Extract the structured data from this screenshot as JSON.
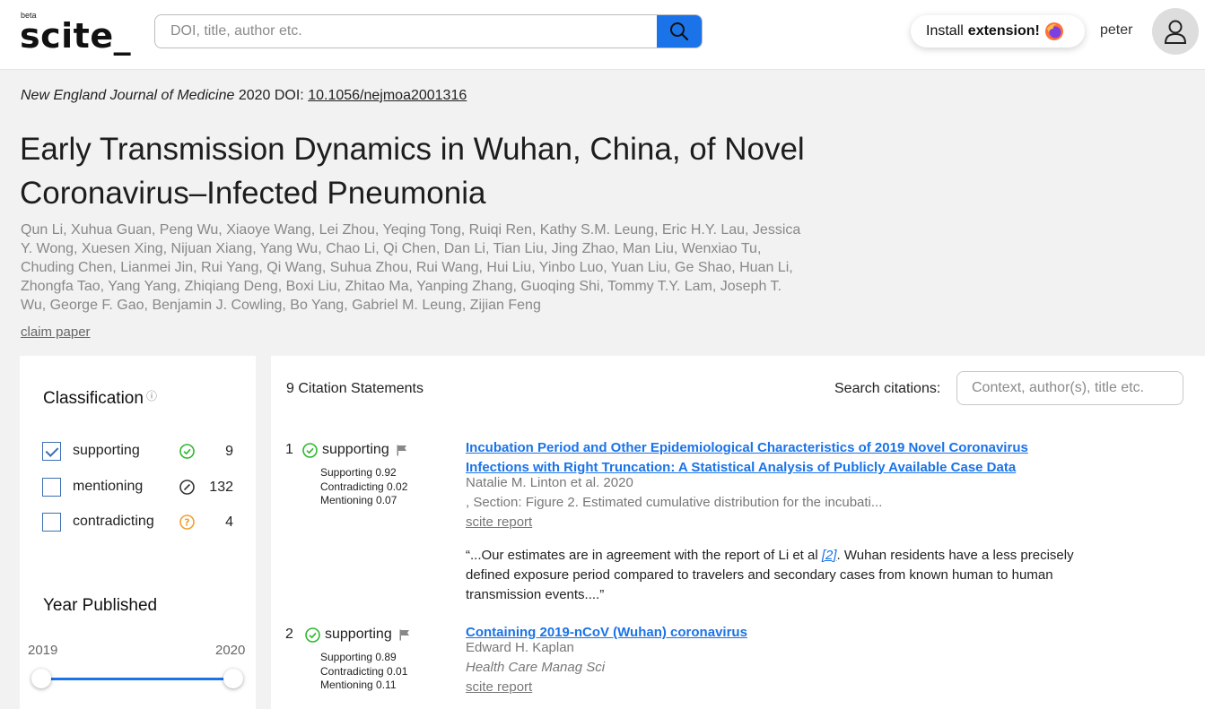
{
  "header": {
    "logo_badge": "beta",
    "logo_text": "scite_",
    "search_placeholder": "DOI, title, author etc.",
    "install_prefix": "Install",
    "install_bold": "extension!",
    "username": "peter"
  },
  "paper": {
    "journal": "New England Journal of Medicine",
    "year": "2020",
    "doi_label": "DOI:",
    "doi": "10.1056/nejmoa2001316",
    "title": "Early Transmission Dynamics in Wuhan, China, of Novel Coronavirus–Infected Pneumonia",
    "authors": "Qun Li, Xuhua Guan, Peng Wu, Xiaoye Wang, Lei Zhou, Yeqing Tong, Ruiqi Ren, Kathy S.M. Leung, Eric H.Y. Lau, Jessica Y. Wong, Xuesen Xing, Nijuan Xiang, Yang Wu, Chao Li, Qi Chen, Dan Li, Tian Liu, Jing Zhao, Man Liu, Wenxiao Tu, Chuding Chen, Lianmei Jin, Rui Yang, Qi Wang, Suhua Zhou, Rui Wang, Hui Liu, Yinbo Luo, Yuan Liu, Ge Shao, Huan Li, Zhongfa Tao, Yang Yang, Zhiqiang Deng, Boxi Liu, Zhitao Ma, Yanping Zhang, Guoqing Shi, Tommy T.Y. Lam, Joseph T. Wu, George F. Gao, Benjamin J. Cowling, Bo Yang, Gabriel M. Leung, Zijian Feng",
    "claim_label": "claim paper"
  },
  "sidebar": {
    "classification_title": "Classification",
    "classes": [
      {
        "label": "supporting",
        "count": "9",
        "checked": true,
        "icon": "check-circle-icon",
        "color": "#2eb82e"
      },
      {
        "label": "mentioning",
        "count": "132",
        "checked": false,
        "icon": "slash-circle-icon",
        "color": "#333333"
      },
      {
        "label": "contradicting",
        "count": "4",
        "checked": false,
        "icon": "question-circle-icon",
        "color": "#f0a030"
      }
    ],
    "year_title": "Year Published",
    "year_min": "2019",
    "year_max": "2020"
  },
  "main": {
    "count_title": "9 Citation Statements",
    "search_label": "Search citations:",
    "search_placeholder": "Context, author(s), title etc.",
    "citations": [
      {
        "num": "1",
        "status": "supporting",
        "supporting": "Supporting 0.92",
        "contradicting": "Contradicting 0.02",
        "mentioning": "Mentioning 0.07",
        "title": "Incubation Period and Other Epidemiological Characteristics of 2019 Novel Coronavirus Infections with Right Truncation: A Statistical Analysis of Publicly Available Case Data",
        "authors": "Natalie M. Linton et al. 2020",
        "section": ", Section: Figure 2. Estimated cumulative distribution for the incubati...",
        "report": "scite report",
        "quote_before": "“...Our estimates are in agreement with the report of Li et al ",
        "quote_ref": "[2]",
        "quote_after": ". Wuhan residents have a less precisely defined exposure period compared to travelers and secondary cases from known human to human transmission events....”"
      },
      {
        "num": "2",
        "status": "supporting",
        "supporting": "Supporting 0.89",
        "contradicting": "Contradicting 0.01",
        "mentioning": "Mentioning 0.11",
        "title": "Containing 2019-nCoV (Wuhan) coronavirus",
        "authors": "Edward H. Kaplan",
        "journal": "Health Care Manag Sci",
        "report": "scite report"
      }
    ]
  },
  "colors": {
    "accent": "#1a73e8",
    "supporting": "#2eb82e",
    "contradicting": "#f0a030"
  }
}
